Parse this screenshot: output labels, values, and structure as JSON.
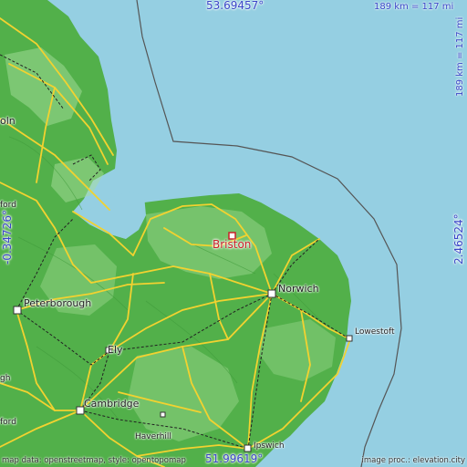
{
  "map": {
    "coords": {
      "top": "53.69457°",
      "bottom": "51.99619°",
      "left": "-0.34726°",
      "right": "2.46524°"
    },
    "scale": {
      "top": "189 km = 117 mi",
      "right": "189 km = 117 mi"
    },
    "pin": {
      "label": "Briston",
      "color": "#cc1f2a"
    },
    "places": {
      "norwich": "Norwich",
      "lowestoft": "Lowestoft",
      "peterborough": "Peterborough",
      "ely": "Ely",
      "cambridge": "Cambridge",
      "haverhill": "Haverhill",
      "ipswich": "Ipswich",
      "lincoln_partial": "oln",
      "spalding_partial": "ford",
      "left_partial": "gh",
      "bottom_left_partial": "ford"
    },
    "attribution": {
      "left": "map data: openstreetmap, style: opentopomap",
      "right": "image proc.: elevation.city"
    },
    "colors": {
      "sea": "#95cfe2",
      "land": "#52b04a",
      "land_light": "#8fd184",
      "roads": "#f2d230",
      "rail": "#222222",
      "coord_text": "#3a46c8"
    }
  }
}
